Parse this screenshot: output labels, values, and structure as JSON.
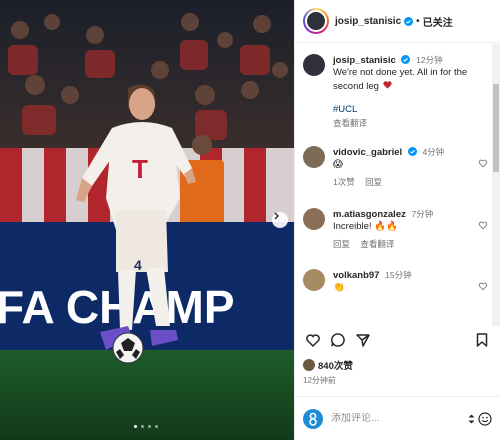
{
  "photo": {
    "banner_text": "FA CHAMP",
    "jersey_number": "4",
    "slide_count": 4,
    "active_slide": 1
  },
  "header": {
    "username": "josip_stanisic",
    "separator": "•",
    "follow_status": "已关注"
  },
  "caption": {
    "username": "josip_stanisic",
    "time": "12分钟",
    "text": "We're not done yet. All in for the second leg",
    "hashtag": "#UCL",
    "translate": "查看翻译"
  },
  "comments": [
    {
      "username": "vidovic_gabriel",
      "time": "4分钟",
      "text": "😱",
      "likes": "1次赞",
      "reply": "回复"
    },
    {
      "username": "m.atiasgonzalez",
      "time": "7分钟",
      "text": "Increible! 🔥🔥",
      "reply": "回复",
      "translate": "查看翻译"
    },
    {
      "username": "volkanb97",
      "time": "15分钟",
      "text": "👏"
    }
  ],
  "likes": {
    "count": "840次赞"
  },
  "post_time": "12分钟前",
  "add_comment": {
    "placeholder": "添加评论..."
  },
  "colors": {
    "verified": "#0095f6",
    "hashtag": "#00376b",
    "secondary_text": "#737373",
    "brand_blue": "#1f8dd6"
  }
}
